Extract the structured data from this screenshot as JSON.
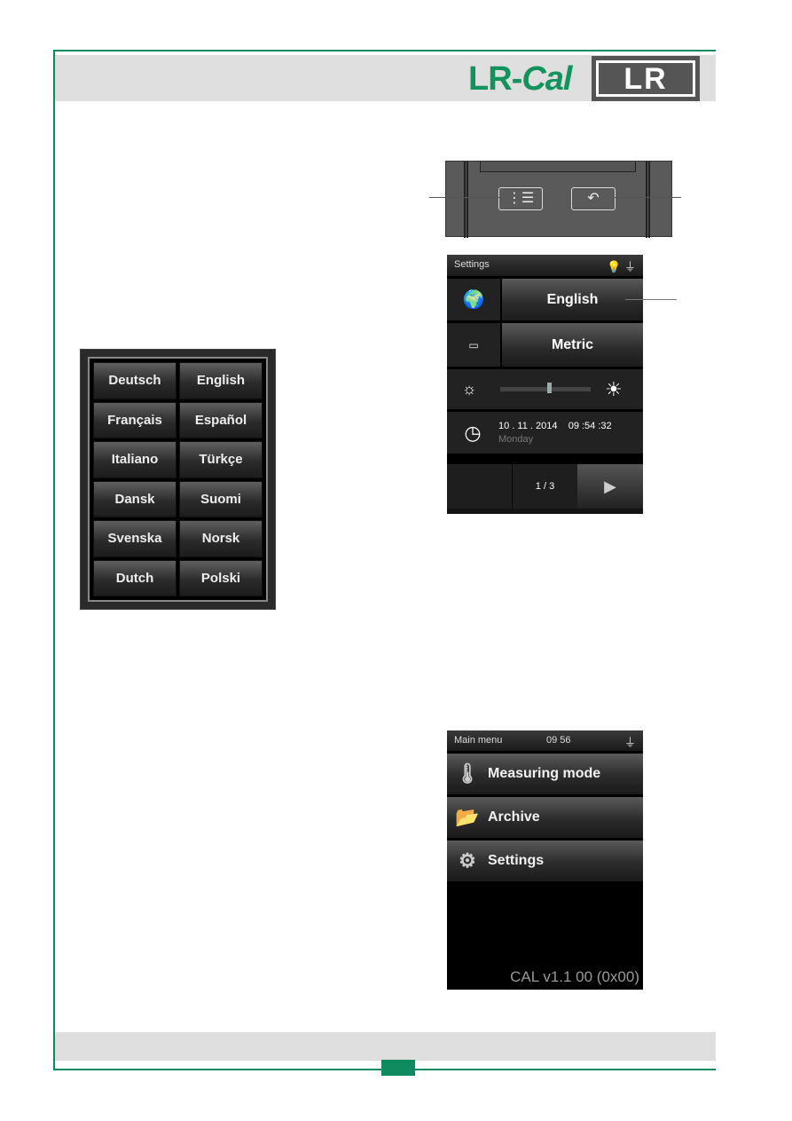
{
  "header": {
    "logo_text": "LR-",
    "logo_italic": "Cal",
    "brand_box": "LR"
  },
  "hardware_keys": {
    "menu_icon": "list-icon",
    "back_icon": "undo-icon"
  },
  "settings_screen": {
    "title": "Settings",
    "status_icons": [
      "bulb-icon",
      "plug-icon"
    ],
    "language": "English",
    "units": "Metric",
    "brightness_percent": 55,
    "date": "10 . 11 . 2014",
    "time": "09 :54 :32",
    "weekday": "Monday",
    "page": "1 / 3"
  },
  "language_picker": {
    "options": [
      "Deutsch",
      "English",
      "Français",
      "Español",
      "Italiano",
      "Türkçe",
      "Dansk",
      "Suomi",
      "Svenska",
      "Norsk",
      "Dutch",
      "Polski"
    ]
  },
  "main_menu": {
    "title": "Main menu",
    "time": "09 56",
    "items": [
      {
        "label": "Measuring mode",
        "icon": "device-probe-icon"
      },
      {
        "label": "Archive",
        "icon": "folder-icon"
      },
      {
        "label": "Settings",
        "icon": "gears-icon"
      }
    ],
    "version": "CAL v1.1 00 (0x00)"
  },
  "colors": {
    "brand_green": "#12925c",
    "frame_green": "#0f8a5f"
  }
}
